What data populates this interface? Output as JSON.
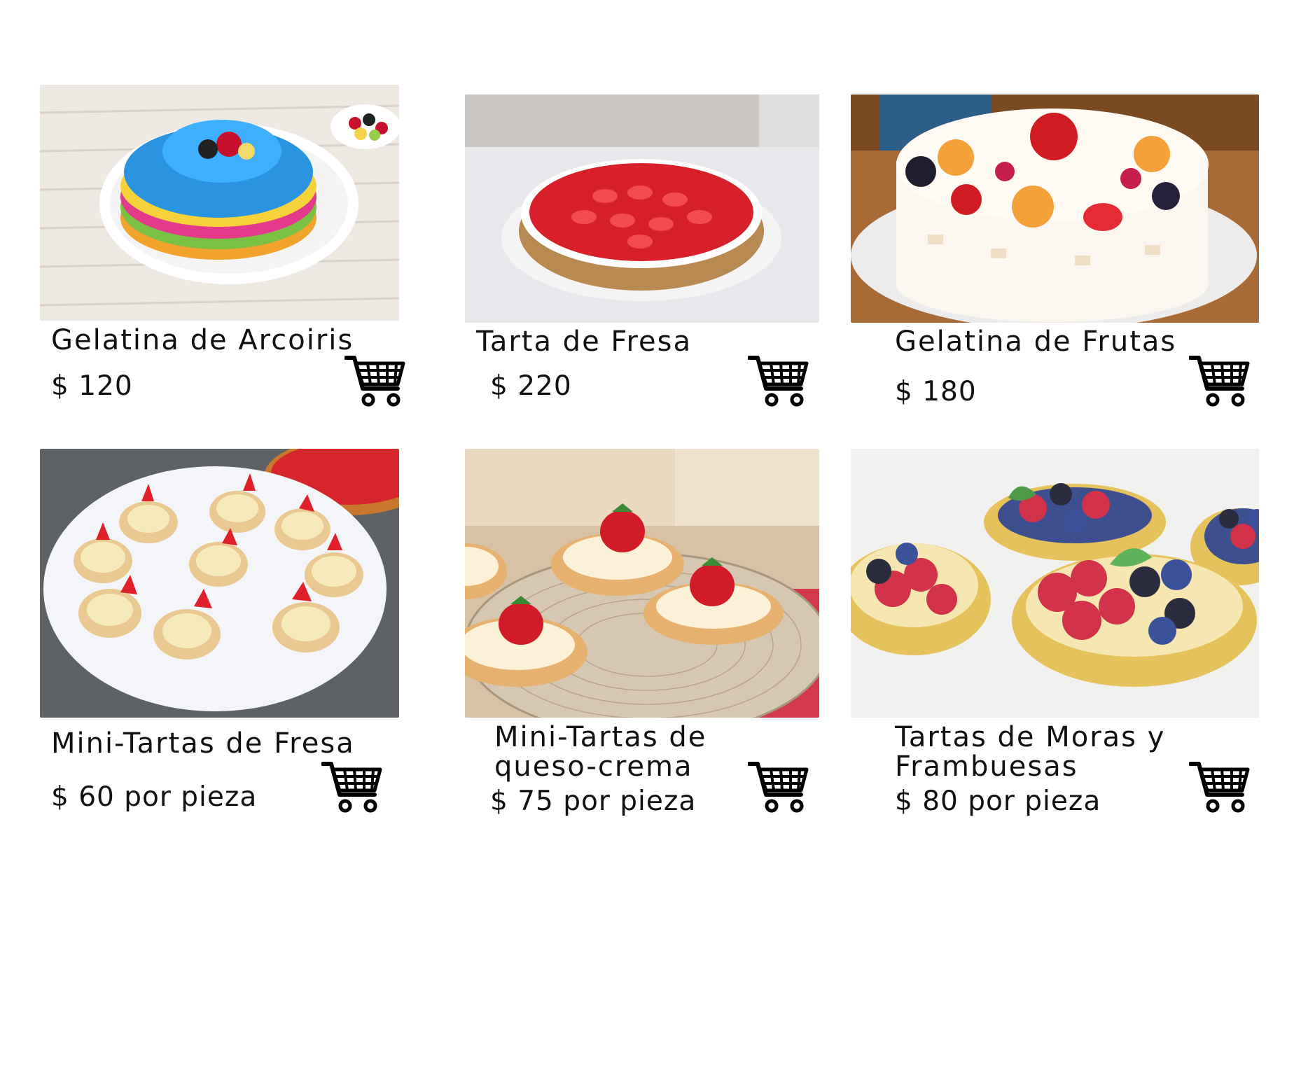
{
  "products": [
    {
      "name": "Gelatina de Arcoiris",
      "price": "$ 120",
      "image": "rainbow-jelly-photo"
    },
    {
      "name": "Tarta de Fresa",
      "price": "$ 220",
      "image": "strawberry-tart-photo"
    },
    {
      "name": "Gelatina de Frutas",
      "price": "$ 180",
      "image": "fruit-jelly-photo"
    },
    {
      "name": "Mini-Tartas de Fresa",
      "price": "$ 60 por pieza",
      "image": "mini-strawberry-tarts-photo"
    },
    {
      "name_line1": "Mini-Tartas de",
      "name_line2": "queso-crema",
      "price": "$ 75 por pieza",
      "image": "cream-cheese-tarts-photo"
    },
    {
      "name_line1": "Tartas de Moras y",
      "name_line2": "Frambuesas",
      "price": "$ 80 por pieza",
      "image": "berry-tarts-photo"
    }
  ],
  "icons": {
    "cart": "shopping-cart-icon"
  },
  "colors": {
    "text": "#111111",
    "background": "#ffffff"
  }
}
